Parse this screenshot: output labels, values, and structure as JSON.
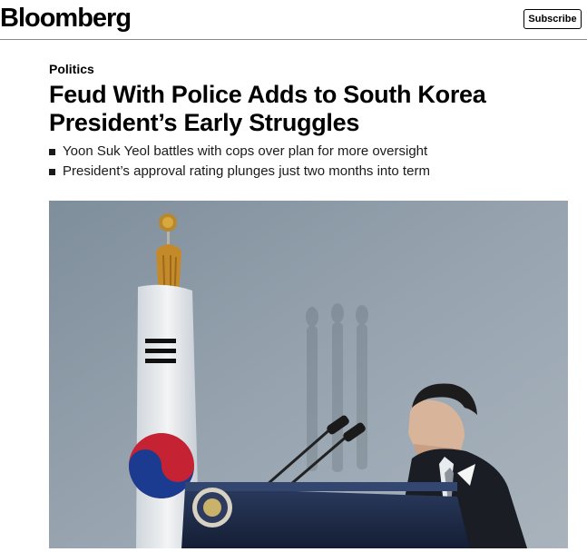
{
  "header": {
    "brand": "Bloomberg",
    "subscribe_label": "Subscribe"
  },
  "article": {
    "section": "Politics",
    "headline": "Feud With Police Adds to South Korea President’s Early Struggles",
    "bullets": [
      "Yoon Suk Yeol battles with cops over plan for more oversight",
      "President’s approval rating plunges just two months into term"
    ]
  },
  "colors": {
    "background": "#ffffff",
    "text": "#000000",
    "rule": "#8a8a8a",
    "photo_backdrop": "#8e9ba8",
    "podium": "#1d2b4a"
  },
  "icons": {
    "bullet": "square-bullet-icon"
  }
}
